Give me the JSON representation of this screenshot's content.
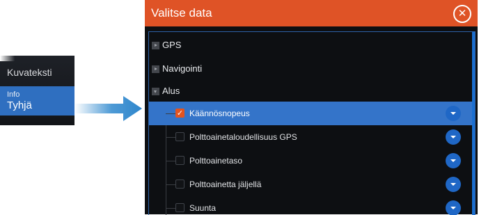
{
  "left_panel": {
    "caption_label": "Kuvateksti",
    "info_label": "Info",
    "info_value": "Tyhjä"
  },
  "dialog": {
    "title": "Valitse data",
    "close_icon": "close-icon",
    "categories": [
      {
        "label": "GPS",
        "expanded": false
      },
      {
        "label": "Navigointi",
        "expanded": false
      },
      {
        "label": "Alus",
        "expanded": true
      }
    ],
    "items": [
      {
        "label": "Käännösnopeus",
        "checked": true,
        "selected": true
      },
      {
        "label": "Polttoainetaloudellisuus GPS",
        "checked": false,
        "selected": false
      },
      {
        "label": "Polttoainetaso",
        "checked": false,
        "selected": false
      },
      {
        "label": "Polttoainetta jäljellä",
        "checked": false,
        "selected": false
      },
      {
        "label": "Suunta",
        "checked": false,
        "selected": false
      }
    ]
  },
  "colors": {
    "title_bar": "#df5326",
    "selection": "#3474c9",
    "arrow": "#3a8fd1",
    "dropdown": "#1f67c6"
  }
}
